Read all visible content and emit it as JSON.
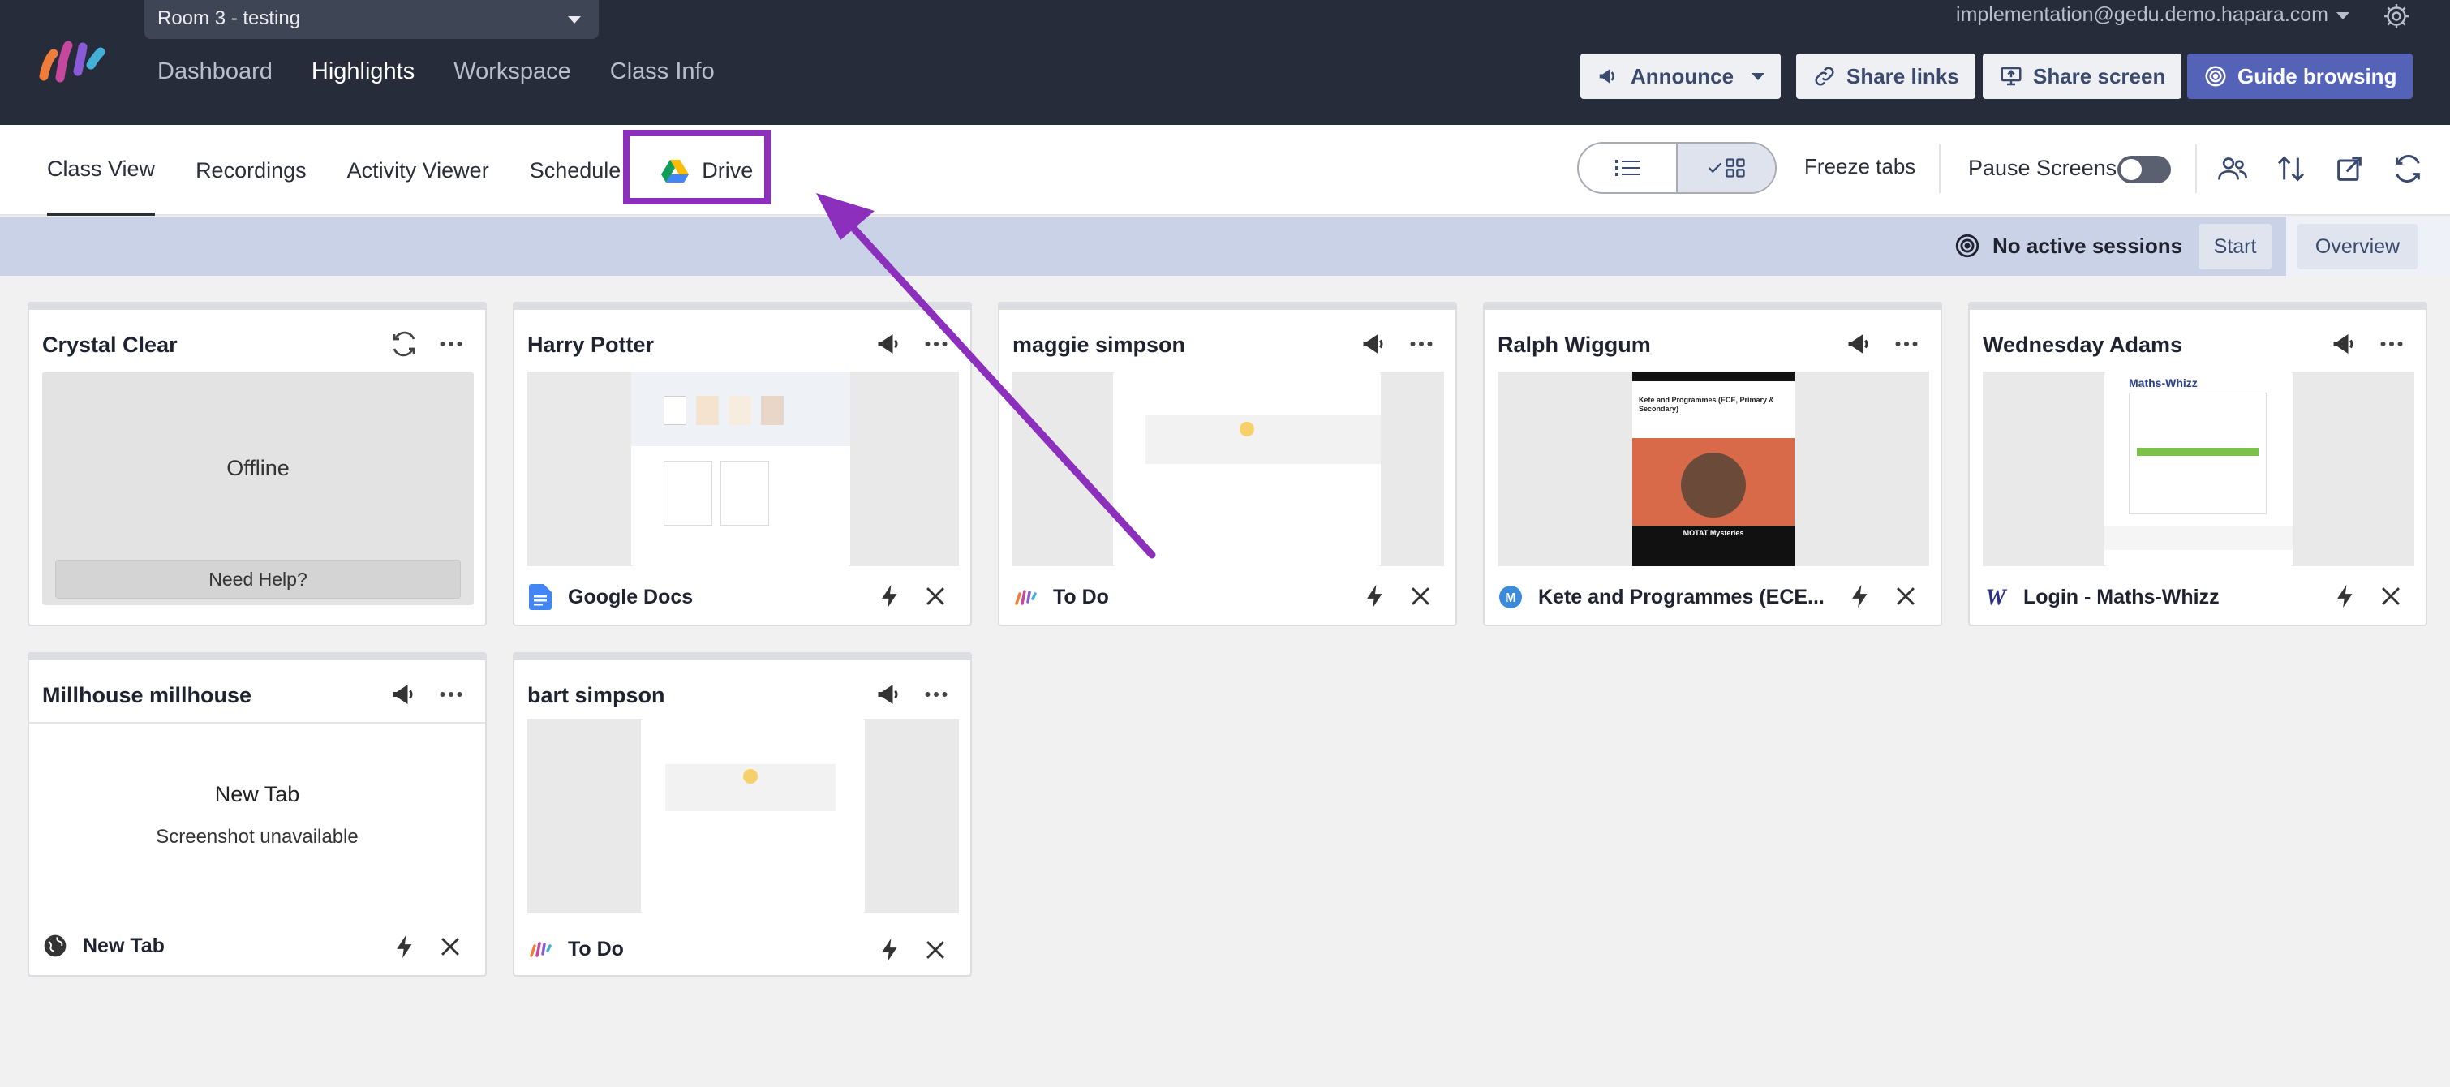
{
  "header": {
    "room_selector": "Room 3 - testing",
    "nav": [
      "Dashboard",
      "Highlights",
      "Workspace",
      "Class Info"
    ],
    "active_nav": "Highlights",
    "account_email": "implementation@gedu.demo.hapara.com",
    "buttons": {
      "announce": "Announce",
      "share_links": "Share links",
      "share_screen": "Share screen",
      "guide_browsing": "Guide browsing"
    }
  },
  "subnav": {
    "tabs": [
      "Class View",
      "Recordings",
      "Activity Viewer",
      "Schedule",
      "Drive"
    ],
    "active_tab": "Class View",
    "freeze_tabs": "Freeze tabs",
    "pause_screens": "Pause Screens"
  },
  "sessions": {
    "status": "No active sessions",
    "start": "Start",
    "overview": "Overview"
  },
  "students": [
    {
      "name": "Crystal Clear",
      "state": "Offline",
      "help": "Need Help?"
    },
    {
      "name": "Harry Potter",
      "tab_title": "Google Docs",
      "favicon": "google-docs-icon"
    },
    {
      "name": "maggie simpson",
      "tab_title": "To Do",
      "favicon": "hapara-icon"
    },
    {
      "name": "Ralph Wiggum",
      "tab_title": "Kete and Programmes (ECE...",
      "favicon": "kete-icon",
      "shot": {
        "title": "Kete and Programmes (ECE, Primary & Secondary)",
        "banner": "MOTAT Mysteries"
      }
    },
    {
      "name": "Wednesday Adams",
      "tab_title": "Login - Maths-Whizz",
      "favicon": "maths-whizz-icon",
      "shot": {
        "brand": "Maths-Whizz"
      }
    },
    {
      "name": "Millhouse millhouse",
      "tab_title": "New Tab",
      "favicon": "globe-icon",
      "shot": {
        "title": "New Tab",
        "note": "Screenshot unavailable"
      }
    },
    {
      "name": "bart simpson",
      "tab_title": "To Do",
      "favicon": "hapara-icon"
    }
  ],
  "colors": {
    "topbar": "#262c3a",
    "highlight": "#8c2fbd",
    "primary_button": "#5462b8",
    "session_bar": "#c9d2e6"
  }
}
